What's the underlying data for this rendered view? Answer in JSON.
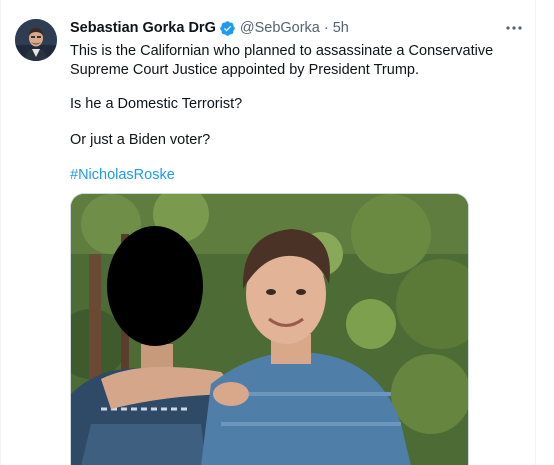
{
  "tweet": {
    "author": {
      "display_name": "Sebastian Gorka DrG",
      "handle": "@SebGorka",
      "verified": true,
      "avatar_icon": "profile-photo"
    },
    "separator": "·",
    "time": "5h",
    "more_icon": "more-horizontal-icon",
    "text_line1": "This is the Californian who planned to assassinate a Conservative Supreme Court Justice appointed by President Trump.",
    "text_line2": "Is he a Domestic Terrorist?",
    "text_line3": "Or just a Biden voter?",
    "hashtag": "#NicholasRoske",
    "media": {
      "type": "photo"
    }
  },
  "colors": {
    "link": "#1d9bf0",
    "secondary_text": "#536471",
    "primary_text": "#0f1419",
    "verified_badge": "#1d9bf0"
  }
}
